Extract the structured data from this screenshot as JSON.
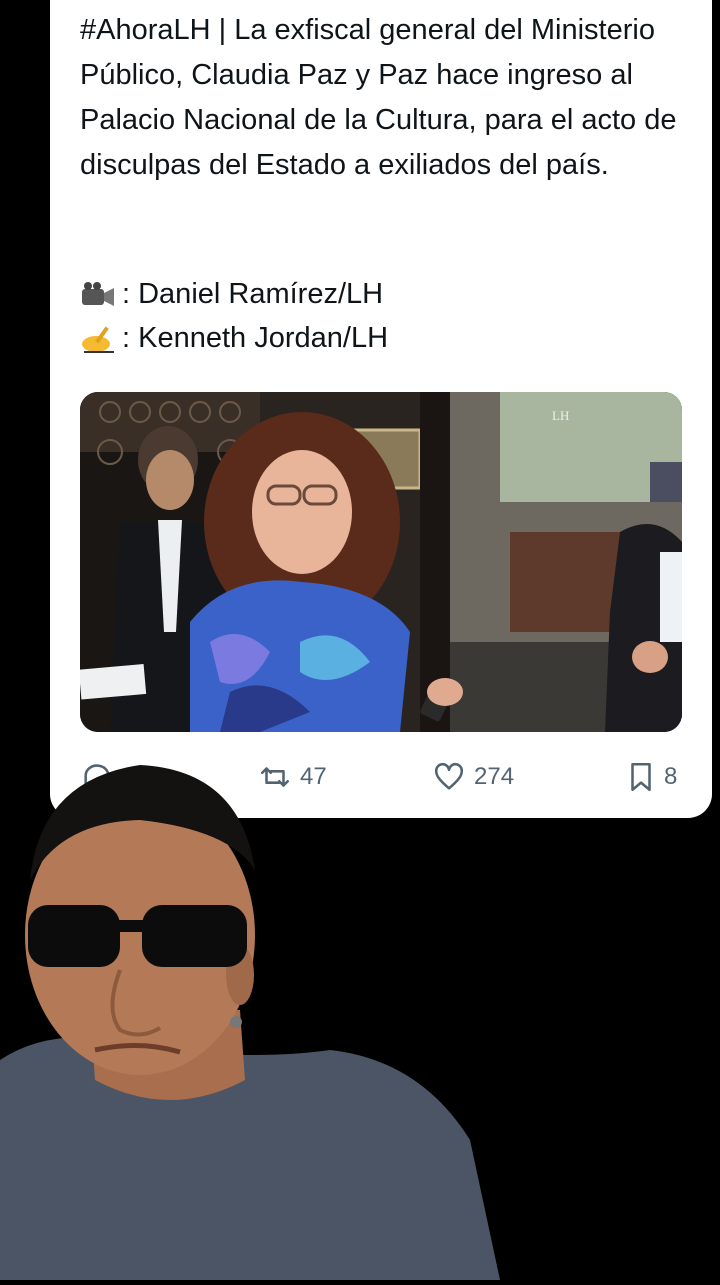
{
  "tweet": {
    "text": "#AhoraLH | La exfiscal general del Ministerio Público, Claudia Paz y Paz hace ingreso al Palacio Nacional de la Cultura, para el acto de disculpas del Estado a exiliados del país.",
    "credit_video_icon": "video-camera-icon",
    "credit_video": ": Daniel Ramírez/LH",
    "credit_text_icon": "writing-hand-icon",
    "credit_text": ": Kenneth Jordan/LH",
    "media_watermark": "LH"
  },
  "actions": {
    "reply_icon": "reply-icon",
    "retweet_icon": "retweet-icon",
    "retweet_count": "47",
    "like_icon": "heart-icon",
    "like_count": "274",
    "bookmark_icon": "bookmark-icon",
    "bookmark_count": "8"
  },
  "colors": {
    "card_bg": "#ffffff",
    "page_bg": "#000000",
    "text": "#0f1419",
    "muted": "#536471"
  }
}
